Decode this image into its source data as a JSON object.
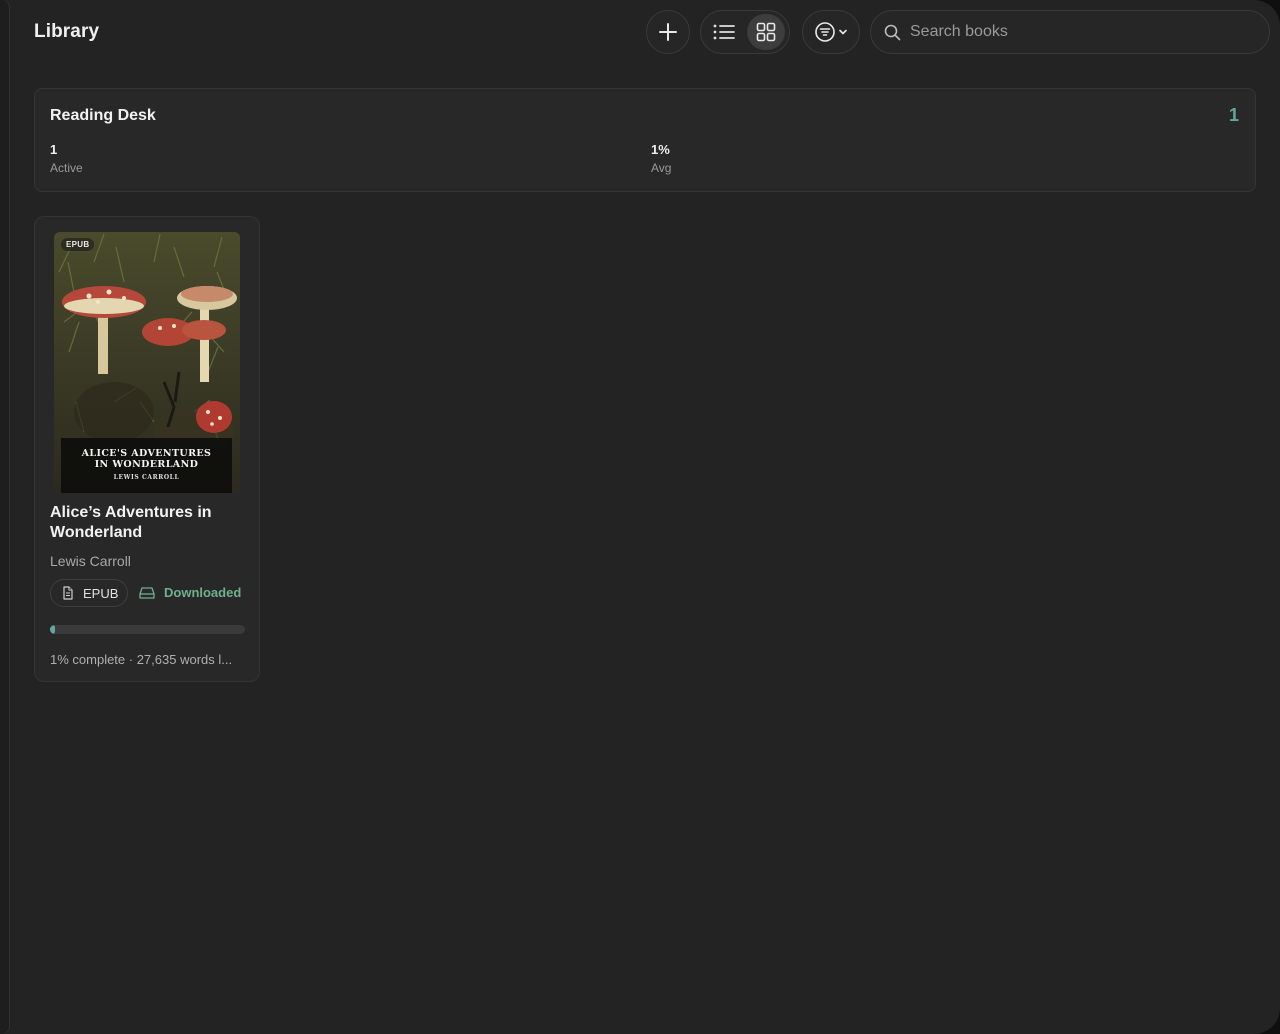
{
  "header": {
    "title": "Library",
    "search_placeholder": "Search books",
    "view_mode": "grid"
  },
  "icons": {
    "add": "plus-icon",
    "list": "list-icon",
    "grid": "grid-icon",
    "filter": "filter-icon",
    "search": "search-icon"
  },
  "reading_desk": {
    "title": "Reading Desk",
    "count": "1",
    "stats": [
      {
        "value": "1",
        "label": "Active"
      },
      {
        "value": "1%",
        "label": "Avg"
      }
    ]
  },
  "books": [
    {
      "cover_badge": "EPUB",
      "cover_title": "ALICE'S ADVENTURES IN WONDERLAND",
      "cover_author": "LEWIS CARROLL",
      "title": "Alice’s Adventures in Wonderland",
      "author": "Lewis Carroll",
      "format": "EPUB",
      "status": "Downloaded",
      "progress": 0.01,
      "progress_text": "1% complete · 27,635 words l..."
    }
  ],
  "colors": {
    "accent": "#5fa8a4",
    "downloaded": "#6fb08c",
    "background": "#232323"
  }
}
